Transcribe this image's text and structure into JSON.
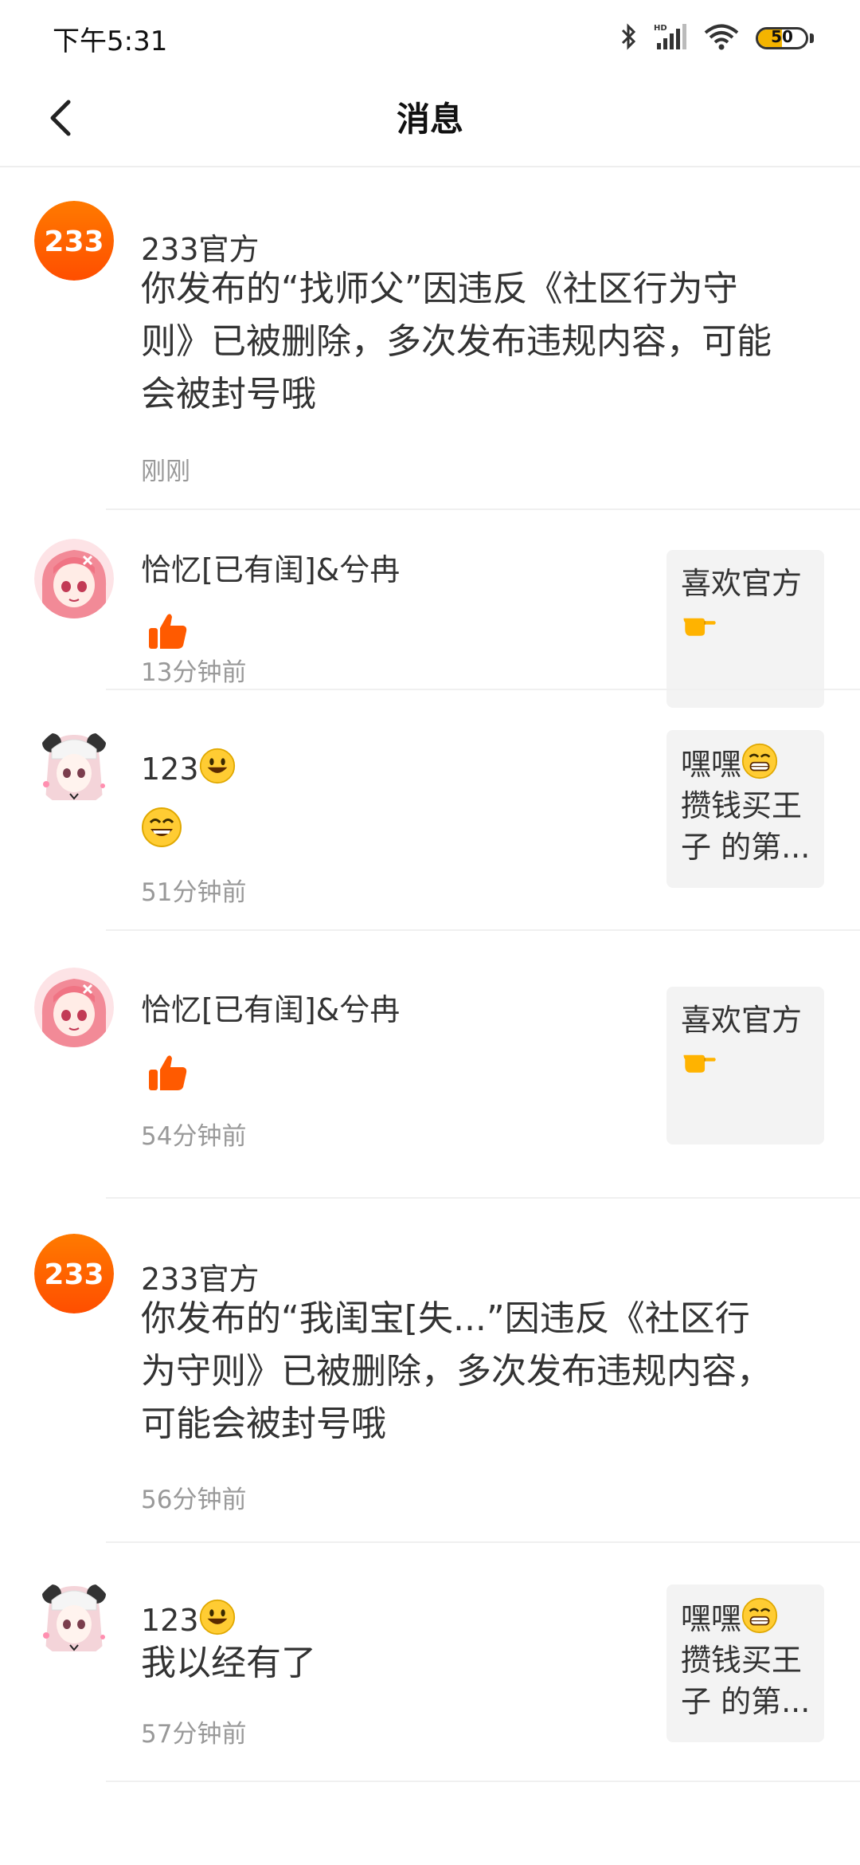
{
  "status_bar": {
    "time": "下午5:31",
    "battery": "50",
    "battery_level": 0.5
  },
  "header": {
    "title": "消息"
  },
  "messages": [
    {
      "type": "official",
      "avatar_text": "233",
      "name": "233官方",
      "content": "你发布的“找师父”因违反《社区行为守则》已被删除，多次发布违规内容，可能会被封号哦",
      "time": "刚刚"
    },
    {
      "type": "like",
      "name": "恰忆[已有闺]&兮冉",
      "icon": "thumbs-up-icon",
      "time": "13分钟前",
      "preview": "喜欢官方",
      "preview_emoji": "pointing-hand-icon"
    },
    {
      "type": "reply",
      "name": "123",
      "name_emoji": "smiley-icon",
      "content_emoji": "grin-icon",
      "time": "51分钟前",
      "preview": "嘿嘿",
      "preview_emoji": "beaming-icon",
      "preview_more": "攒钱买王子 的第..."
    },
    {
      "type": "like",
      "name": "恰忆[已有闺]&兮冉",
      "icon": "thumbs-up-icon",
      "time": "54分钟前",
      "preview": "喜欢官方",
      "preview_emoji": "pointing-hand-icon"
    },
    {
      "type": "official",
      "avatar_text": "233",
      "name": "233官方",
      "content": "你发布的“我闺宝[失...”因违反《社区行为守则》已被删除，多次发布违规内容，可能会被封号哦",
      "time": "56分钟前"
    },
    {
      "type": "reply",
      "name": "123",
      "name_emoji": "smiley-icon",
      "content": "我以经有了",
      "time": "57分钟前",
      "preview": "嘿嘿",
      "preview_emoji": "beaming-icon",
      "preview_more": "攒钱买王子 的第..."
    }
  ],
  "colors": {
    "accent": "#ff6a00",
    "preview_bg": "#f3f3f3",
    "meta_text": "#999999"
  }
}
